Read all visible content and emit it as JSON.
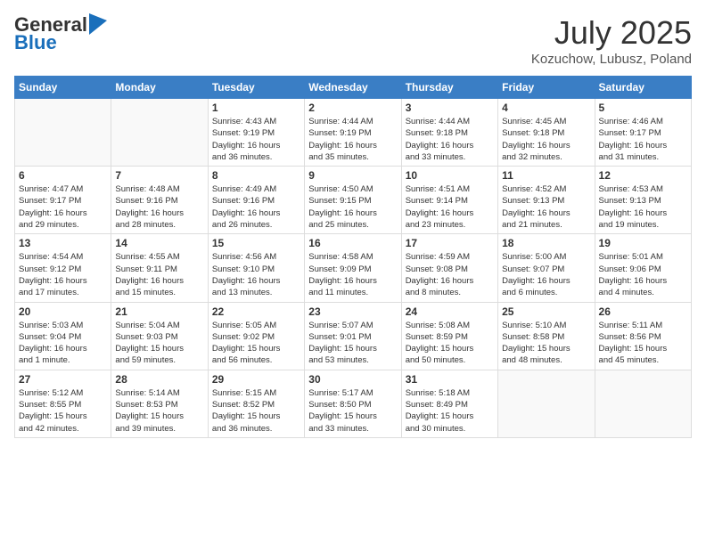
{
  "header": {
    "logo_general": "General",
    "logo_blue": "Blue",
    "month": "July 2025",
    "location": "Kozuchow, Lubusz, Poland"
  },
  "weekdays": [
    "Sunday",
    "Monday",
    "Tuesday",
    "Wednesday",
    "Thursday",
    "Friday",
    "Saturday"
  ],
  "weeks": [
    [
      {
        "day": "",
        "text": ""
      },
      {
        "day": "",
        "text": ""
      },
      {
        "day": "1",
        "text": "Sunrise: 4:43 AM\nSunset: 9:19 PM\nDaylight: 16 hours\nand 36 minutes."
      },
      {
        "day": "2",
        "text": "Sunrise: 4:44 AM\nSunset: 9:19 PM\nDaylight: 16 hours\nand 35 minutes."
      },
      {
        "day": "3",
        "text": "Sunrise: 4:44 AM\nSunset: 9:18 PM\nDaylight: 16 hours\nand 33 minutes."
      },
      {
        "day": "4",
        "text": "Sunrise: 4:45 AM\nSunset: 9:18 PM\nDaylight: 16 hours\nand 32 minutes."
      },
      {
        "day": "5",
        "text": "Sunrise: 4:46 AM\nSunset: 9:17 PM\nDaylight: 16 hours\nand 31 minutes."
      }
    ],
    [
      {
        "day": "6",
        "text": "Sunrise: 4:47 AM\nSunset: 9:17 PM\nDaylight: 16 hours\nand 29 minutes."
      },
      {
        "day": "7",
        "text": "Sunrise: 4:48 AM\nSunset: 9:16 PM\nDaylight: 16 hours\nand 28 minutes."
      },
      {
        "day": "8",
        "text": "Sunrise: 4:49 AM\nSunset: 9:16 PM\nDaylight: 16 hours\nand 26 minutes."
      },
      {
        "day": "9",
        "text": "Sunrise: 4:50 AM\nSunset: 9:15 PM\nDaylight: 16 hours\nand 25 minutes."
      },
      {
        "day": "10",
        "text": "Sunrise: 4:51 AM\nSunset: 9:14 PM\nDaylight: 16 hours\nand 23 minutes."
      },
      {
        "day": "11",
        "text": "Sunrise: 4:52 AM\nSunset: 9:13 PM\nDaylight: 16 hours\nand 21 minutes."
      },
      {
        "day": "12",
        "text": "Sunrise: 4:53 AM\nSunset: 9:13 PM\nDaylight: 16 hours\nand 19 minutes."
      }
    ],
    [
      {
        "day": "13",
        "text": "Sunrise: 4:54 AM\nSunset: 9:12 PM\nDaylight: 16 hours\nand 17 minutes."
      },
      {
        "day": "14",
        "text": "Sunrise: 4:55 AM\nSunset: 9:11 PM\nDaylight: 16 hours\nand 15 minutes."
      },
      {
        "day": "15",
        "text": "Sunrise: 4:56 AM\nSunset: 9:10 PM\nDaylight: 16 hours\nand 13 minutes."
      },
      {
        "day": "16",
        "text": "Sunrise: 4:58 AM\nSunset: 9:09 PM\nDaylight: 16 hours\nand 11 minutes."
      },
      {
        "day": "17",
        "text": "Sunrise: 4:59 AM\nSunset: 9:08 PM\nDaylight: 16 hours\nand 8 minutes."
      },
      {
        "day": "18",
        "text": "Sunrise: 5:00 AM\nSunset: 9:07 PM\nDaylight: 16 hours\nand 6 minutes."
      },
      {
        "day": "19",
        "text": "Sunrise: 5:01 AM\nSunset: 9:06 PM\nDaylight: 16 hours\nand 4 minutes."
      }
    ],
    [
      {
        "day": "20",
        "text": "Sunrise: 5:03 AM\nSunset: 9:04 PM\nDaylight: 16 hours\nand 1 minute."
      },
      {
        "day": "21",
        "text": "Sunrise: 5:04 AM\nSunset: 9:03 PM\nDaylight: 15 hours\nand 59 minutes."
      },
      {
        "day": "22",
        "text": "Sunrise: 5:05 AM\nSunset: 9:02 PM\nDaylight: 15 hours\nand 56 minutes."
      },
      {
        "day": "23",
        "text": "Sunrise: 5:07 AM\nSunset: 9:01 PM\nDaylight: 15 hours\nand 53 minutes."
      },
      {
        "day": "24",
        "text": "Sunrise: 5:08 AM\nSunset: 8:59 PM\nDaylight: 15 hours\nand 50 minutes."
      },
      {
        "day": "25",
        "text": "Sunrise: 5:10 AM\nSunset: 8:58 PM\nDaylight: 15 hours\nand 48 minutes."
      },
      {
        "day": "26",
        "text": "Sunrise: 5:11 AM\nSunset: 8:56 PM\nDaylight: 15 hours\nand 45 minutes."
      }
    ],
    [
      {
        "day": "27",
        "text": "Sunrise: 5:12 AM\nSunset: 8:55 PM\nDaylight: 15 hours\nand 42 minutes."
      },
      {
        "day": "28",
        "text": "Sunrise: 5:14 AM\nSunset: 8:53 PM\nDaylight: 15 hours\nand 39 minutes."
      },
      {
        "day": "29",
        "text": "Sunrise: 5:15 AM\nSunset: 8:52 PM\nDaylight: 15 hours\nand 36 minutes."
      },
      {
        "day": "30",
        "text": "Sunrise: 5:17 AM\nSunset: 8:50 PM\nDaylight: 15 hours\nand 33 minutes."
      },
      {
        "day": "31",
        "text": "Sunrise: 5:18 AM\nSunset: 8:49 PM\nDaylight: 15 hours\nand 30 minutes."
      },
      {
        "day": "",
        "text": ""
      },
      {
        "day": "",
        "text": ""
      }
    ]
  ]
}
